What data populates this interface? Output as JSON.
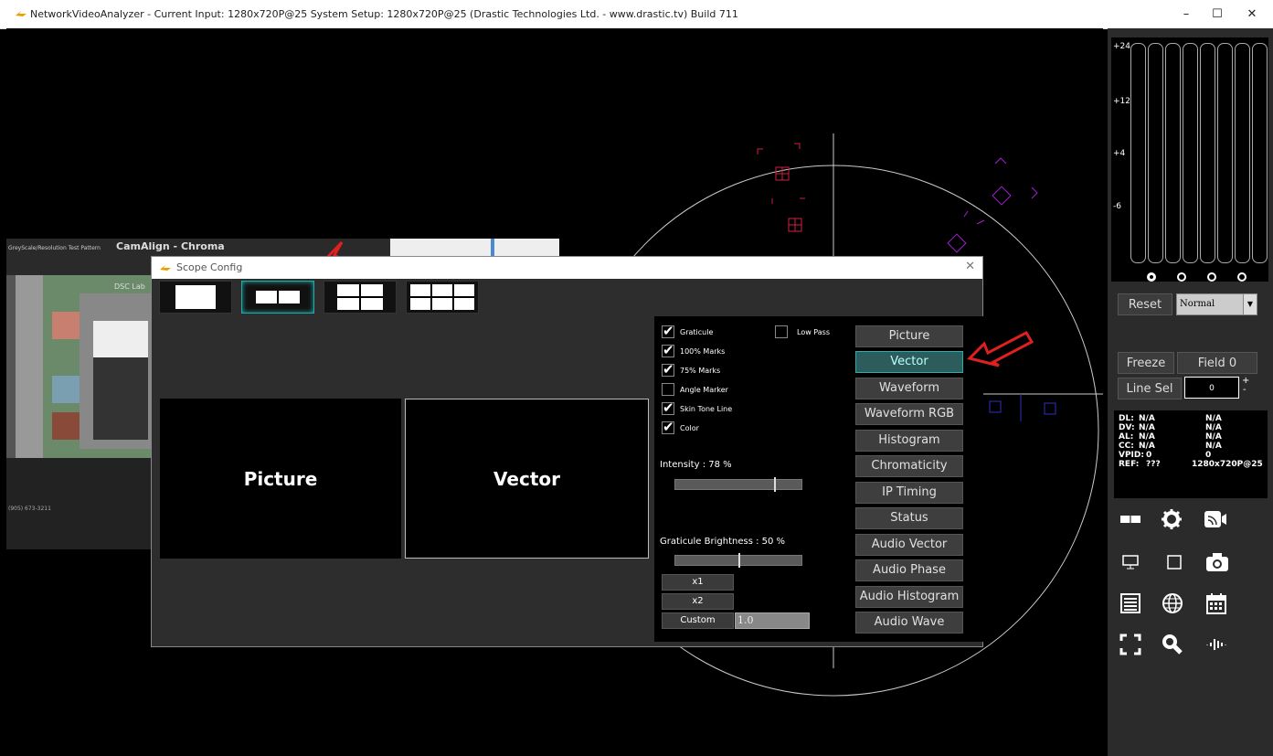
{
  "window": {
    "title": "NetworkVideoAnalyzer -  Current Input: 1280x720P@25  System Setup: 1280x720P@25   (Drastic Technologies Ltd. - www.drastic.tv) Build 711",
    "minimize": "–",
    "maximize": "☐",
    "close": "✕"
  },
  "meters": {
    "labels": [
      "+24",
      "+12",
      "+4",
      "-6"
    ]
  },
  "controls": {
    "reset": "Reset",
    "mode_select": "Normal",
    "freeze": "Freeze",
    "field": "Field 0",
    "line_sel": "Line Sel",
    "line_value": "0",
    "plus": "+",
    "minus": "-"
  },
  "info": [
    {
      "k": "DL:",
      "a": "N/A",
      "b": "N/A"
    },
    {
      "k": "DV:",
      "a": "N/A",
      "b": "N/A"
    },
    {
      "k": "AL:",
      "a": "N/A",
      "b": "N/A"
    },
    {
      "k": "CC:",
      "a": "N/A",
      "b": "N/A"
    },
    {
      "k": "VPID:",
      "a": "0",
      "b": "0"
    },
    {
      "k": "REF:",
      "a": "???",
      "b": "1280x720P@25"
    }
  ],
  "dialog": {
    "title": "Scope Config",
    "close": "✕",
    "preview_left": "Picture",
    "preview_right": "Vector",
    "checkboxes": {
      "graticule": "Graticule",
      "marks100": "100% Marks",
      "marks75": "75% Marks",
      "angle": "Angle Marker",
      "skin": "Skin Tone Line",
      "color": "Color",
      "lowpass": "Low Pass"
    },
    "intensity_label": "Intensity : 78 %",
    "intensity_value": 78,
    "graticule_label": "Graticule Brightness : 50 %",
    "graticule_value": 50,
    "x1": "x1",
    "x2": "x2",
    "custom": "Custom",
    "custom_value": "1.0",
    "scopes": [
      "Picture",
      "Vector",
      "Waveform",
      "Waveform RGB",
      "Histogram",
      "Chromaticity",
      "IP Timing",
      "Status",
      "Audio Vector",
      "Audio Phase",
      "Audio Histogram",
      "Audio Wave"
    ]
  },
  "thumb": {
    "brand": "CamAlign - Chroma",
    "sub": "GreyScale/Resolution Test Pattern",
    "dsc": "DSC Lab",
    "phone": "(905) 673-3211"
  }
}
